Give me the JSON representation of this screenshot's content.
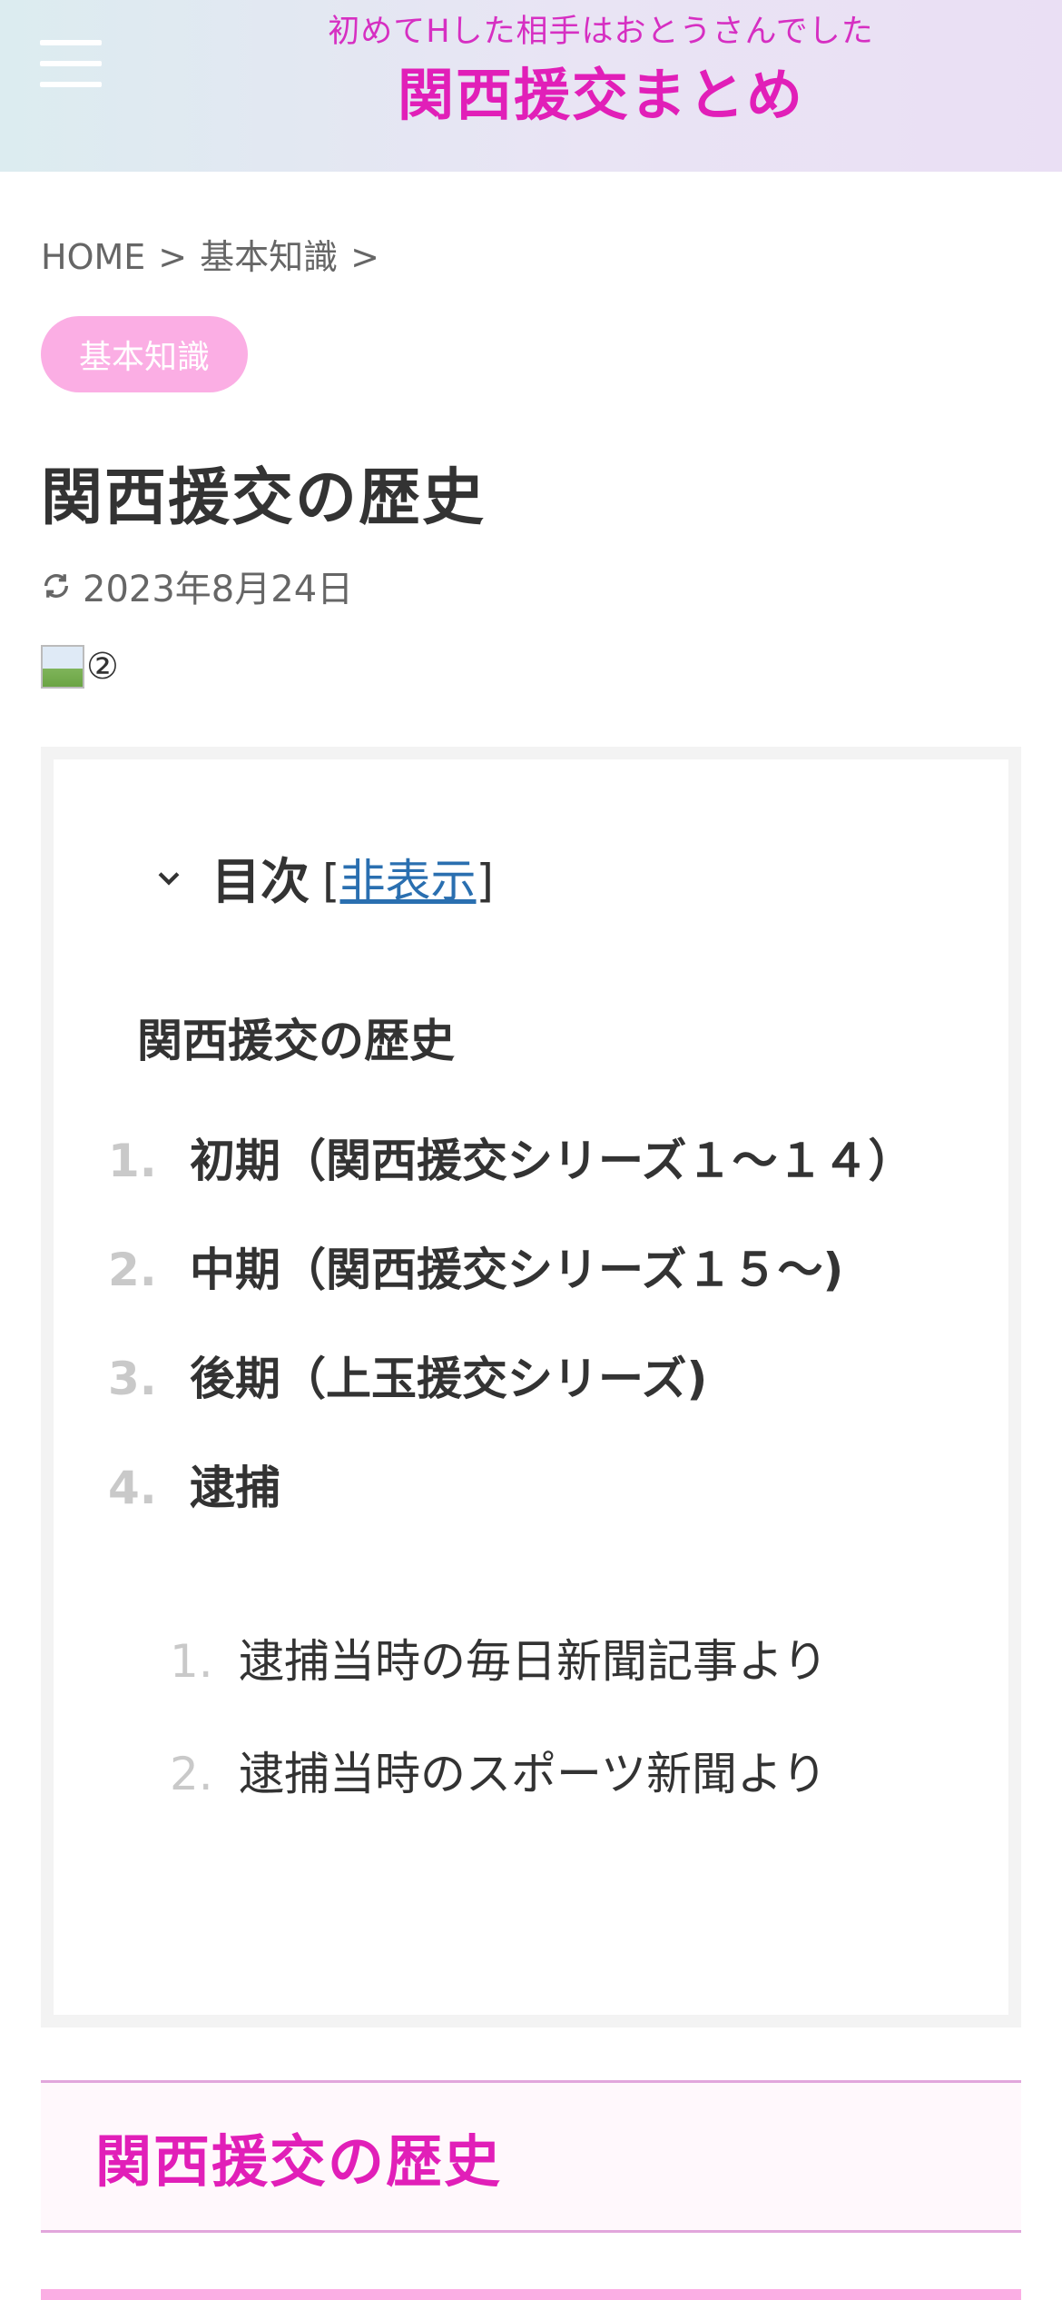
{
  "header": {
    "tagline": "初めてHした相手はおとうさんでした",
    "site_title": "関西援交まとめ"
  },
  "breadcrumb": {
    "home": "HOME",
    "category": "基本知識",
    "separator": ">"
  },
  "category_badge": "基本知識",
  "entry": {
    "title": "関西援交の歴史",
    "updated_date": "2023年8月24日",
    "image_caption": "②"
  },
  "toc": {
    "heading": "目次",
    "toggle_open": "[",
    "toggle_label": "非表示",
    "toggle_close": "]",
    "top_item": "関西援交の歴史",
    "items": [
      {
        "num": "1.",
        "label": "初期（関西援交シリーズ１〜１４）"
      },
      {
        "num": "2.",
        "label": "中期（関西援交シリーズ１５〜)"
      },
      {
        "num": "3.",
        "label": "後期（上玉援交シリーズ)"
      },
      {
        "num": "4.",
        "label": "逮捕"
      }
    ],
    "sub_items": [
      {
        "num": "1.",
        "label": "逮捕当時の毎日新聞記事より"
      },
      {
        "num": "2.",
        "label": "逮捕当時のスポーツ新聞より"
      }
    ]
  },
  "section_heading": "関西援交の歴史",
  "colors": {
    "accent": "#e11fb8",
    "badge": "#fbaee4",
    "link": "#2a6fb0"
  }
}
